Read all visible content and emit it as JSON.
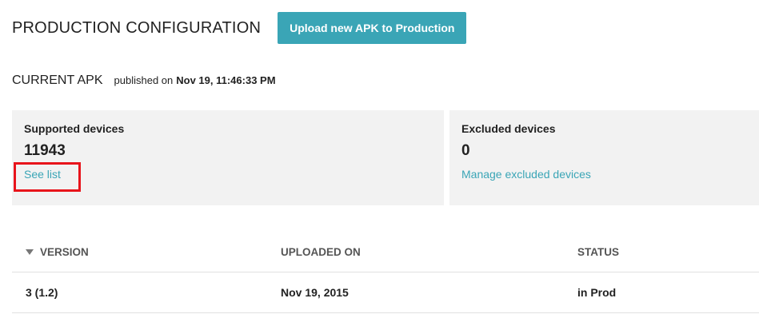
{
  "header": {
    "title": "PRODUCTION CONFIGURATION",
    "upload_button_label": "Upload new APK to Production"
  },
  "current_apk": {
    "title": "CURRENT APK",
    "published_label": "published on",
    "published_date": "Nov 19, 11:46:33 PM"
  },
  "supported_devices": {
    "label": "Supported devices",
    "count": "11943",
    "link_label": "See list"
  },
  "excluded_devices": {
    "label": "Excluded devices",
    "count": "0",
    "link_label": "Manage excluded devices"
  },
  "table": {
    "columns": {
      "version": "VERSION",
      "uploaded_on": "UPLOADED ON",
      "status": "STATUS"
    },
    "rows": [
      {
        "version": "3 (1.2)",
        "uploaded_on": "Nov 19, 2015",
        "status": "in Prod"
      }
    ]
  },
  "colors": {
    "accent": "#3aa5b6",
    "highlight": "#e8141b",
    "panel_background": "#f2f2f2"
  }
}
